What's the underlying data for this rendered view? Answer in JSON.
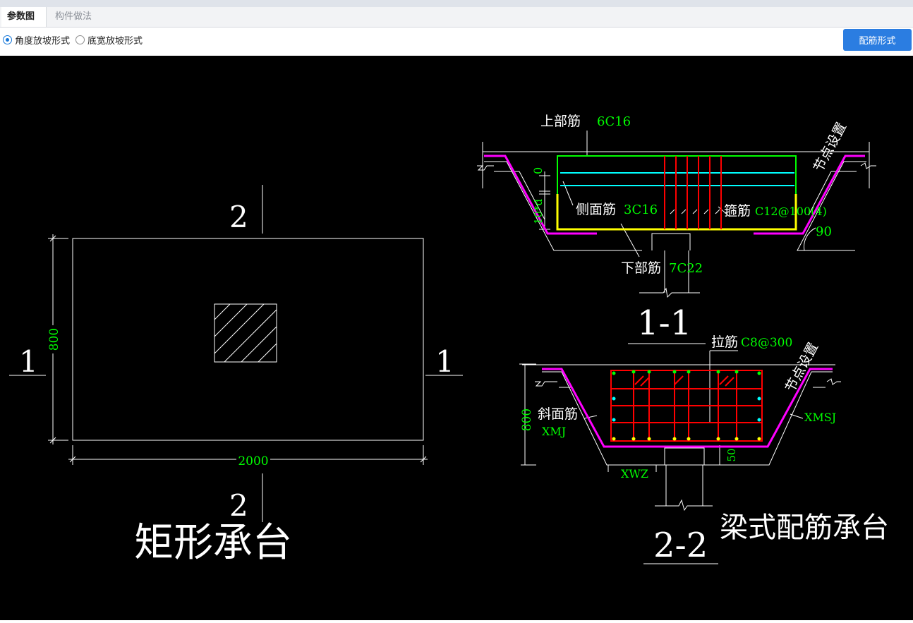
{
  "tabs": [
    {
      "label": "参数图",
      "active": true
    },
    {
      "label": "构件做法",
      "active": false
    }
  ],
  "radio_options": [
    {
      "label": "角度放坡形式",
      "checked": true
    },
    {
      "label": "底宽放坡形式",
      "checked": false
    }
  ],
  "rebar_button_label": "配筋形式",
  "plan": {
    "title": "矩形承台",
    "section_mark_1": "1",
    "section_mark_2": "2",
    "width_dim": "2000",
    "height_dim": "800"
  },
  "section_1_1": {
    "title": "1-1",
    "top_rebar_label": "上部筋",
    "top_rebar_value": "6C16",
    "side_rebar_label": "侧面筋",
    "side_rebar_value": "3C16",
    "stirrup_label": "箍筋",
    "stirrup_value": "C12@100(4)",
    "bottom_rebar_label": "下部筋",
    "bottom_rebar_value": "7C22",
    "node_setting": "节点设置",
    "angle": "90",
    "dim_zero": "0",
    "dim_10d": "10*d"
  },
  "section_2_2": {
    "title": "2-2",
    "tie_label": "拉筋",
    "tie_value": "C8@300",
    "slope_rebar_label": "斜面筋",
    "slope_rebar_code": "XMJ",
    "xmsj": "XMSJ",
    "xwz": "XWZ",
    "dim_800": "800",
    "dim_50": "50",
    "node_setting": "节点设置"
  },
  "type_title": "梁式配筋承台",
  "colors": {
    "green": "#00ff00",
    "cyan": "#00ffff",
    "red": "#ff0000",
    "yellow": "#ffff00",
    "magenta": "#ff00ff",
    "white": "#ffffff",
    "button_blue": "#2b7de1"
  }
}
